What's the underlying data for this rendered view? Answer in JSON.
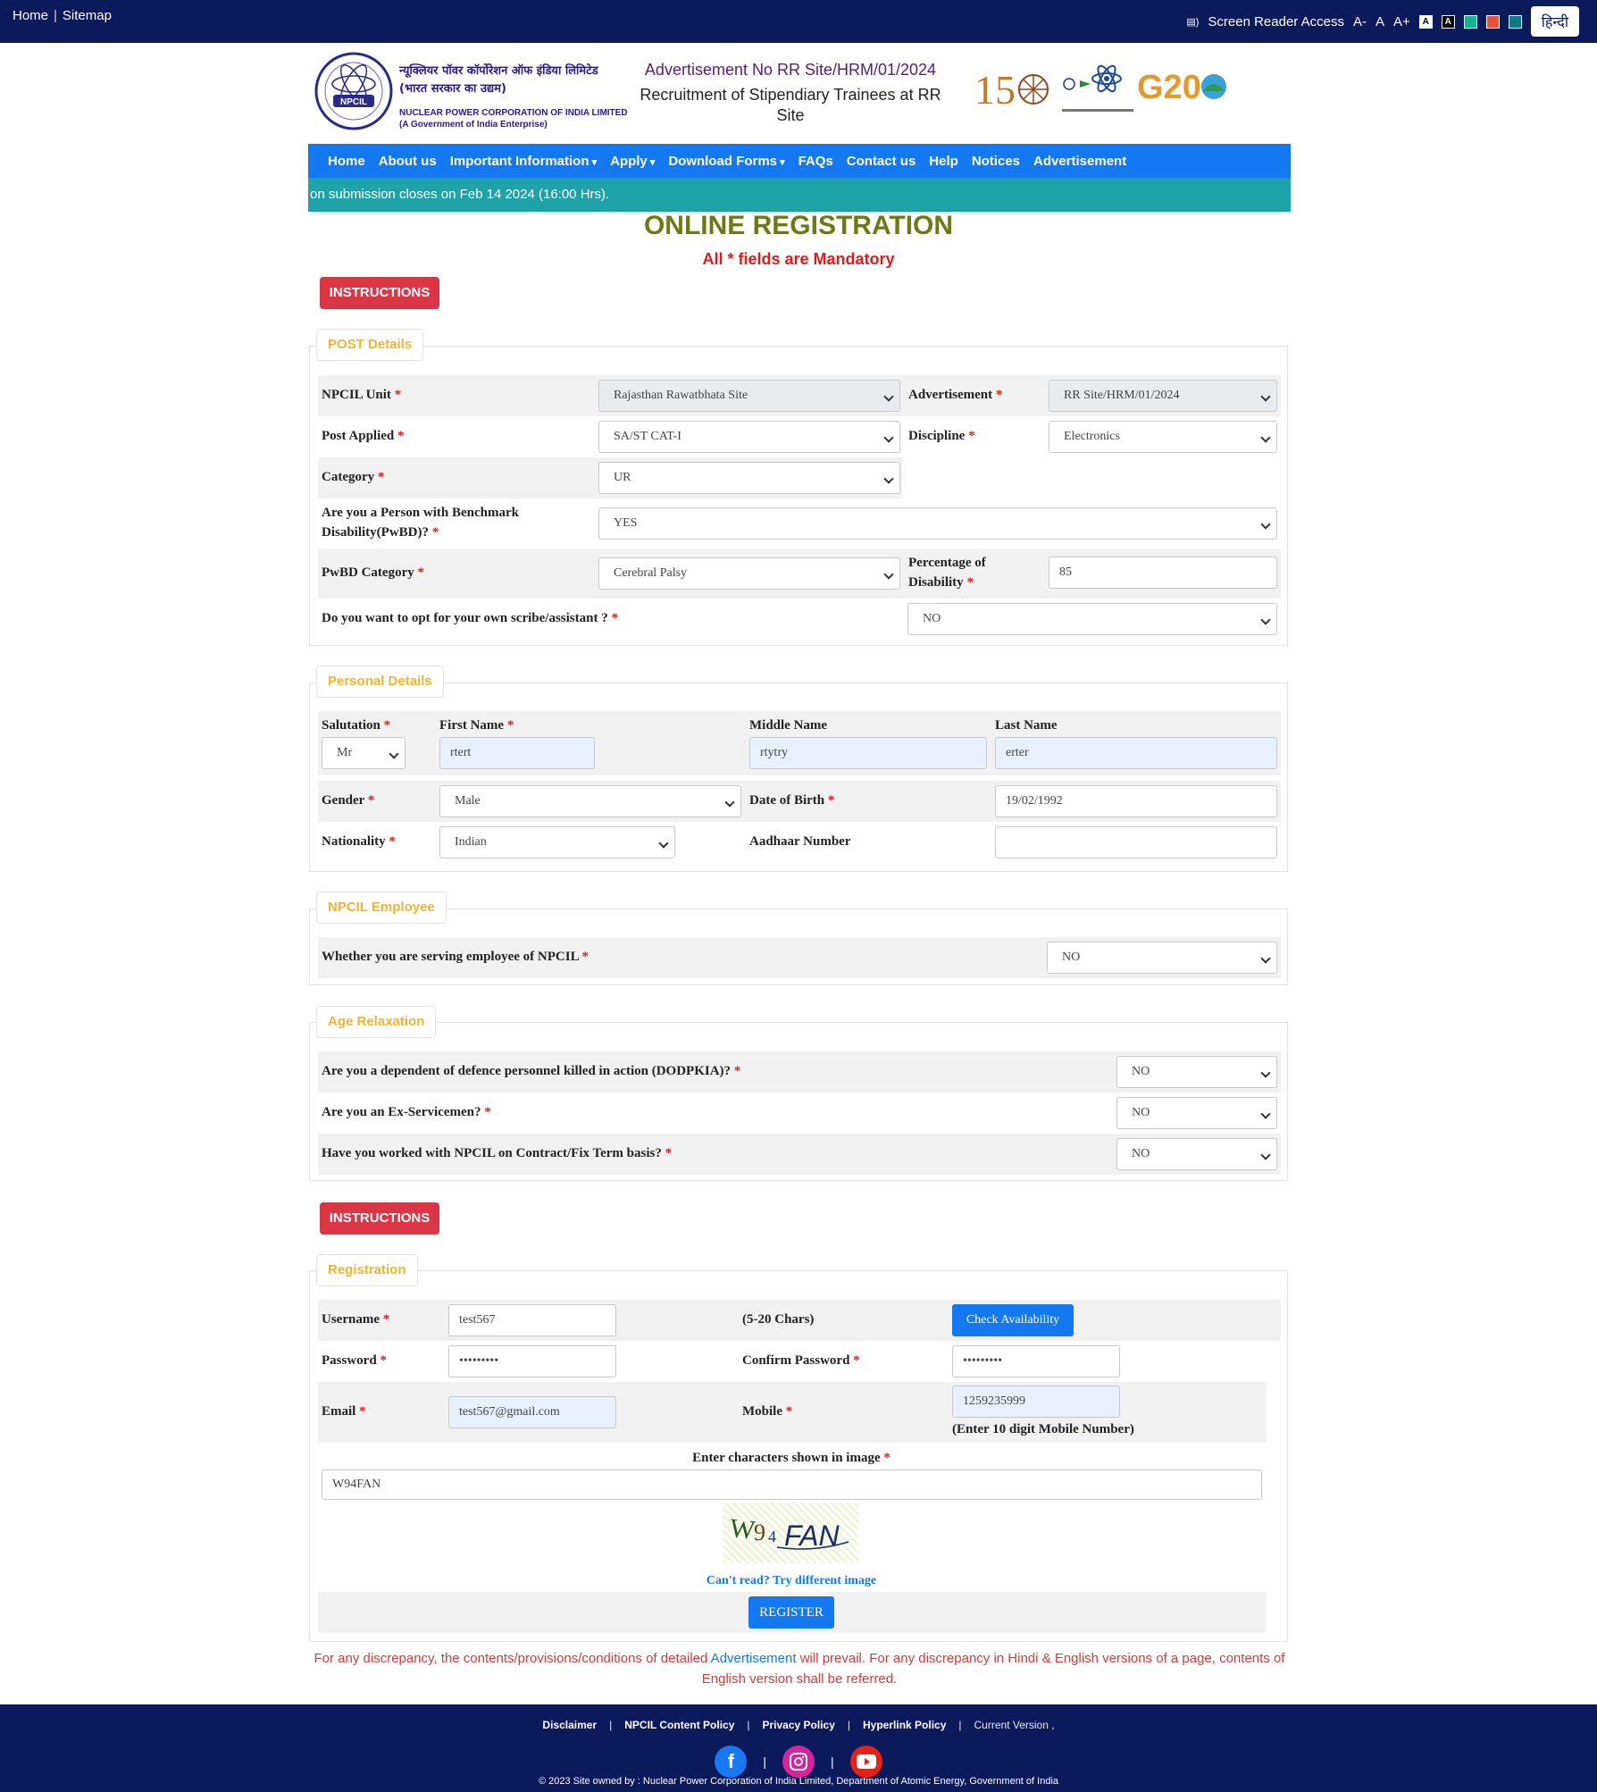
{
  "topbar": {
    "home": "Home",
    "sitemap": "Sitemap",
    "screen_reader": "Screen Reader Access",
    "font_minus": "A-",
    "font_normal": "A",
    "font_plus": "A+",
    "contrast_a1": "A",
    "contrast_a2": "A",
    "hindi": "हिन्दी",
    "theme_colors": [
      "#1ab28c",
      "#e8513c",
      "#127a82"
    ]
  },
  "header": {
    "org_hindi_1": "न्यूक्लियर पॉवर कॉर्पोरेशन ऑफ इंडिया लिमिटेड",
    "org_hindi_2": "(भारत सरकार का उद्यम)",
    "org_english_1": "NUCLEAR POWER CORPORATION OF INDIA LIMITED",
    "org_english_2": "(A Government of India Enterprise)",
    "logo_text": "NPCIL",
    "advertisement_no": "Advertisement No RR Site/HRM/01/2024",
    "recruitment_title": "Recruitment of Stipendiary Trainees at RR Site",
    "g20": "G20"
  },
  "nav": {
    "items": [
      {
        "label": "Home"
      },
      {
        "label": "About us"
      },
      {
        "label": "Important Information"
      },
      {
        "label": "Apply"
      },
      {
        "label": "Download Forms"
      },
      {
        "label": "FAQs"
      },
      {
        "label": "Contact us"
      },
      {
        "label": "Help"
      },
      {
        "label": "Notices"
      },
      {
        "label": "Advertisement"
      }
    ]
  },
  "marquee": "on submission closes on Feb 14 2024 (16:00 Hrs).",
  "title": "ONLINE REGISTRATION",
  "mandatory": "All * fields are Mandatory",
  "instructions_label": "INSTRUCTIONS",
  "post": {
    "legend": "POST Details",
    "unit_label": "NPCIL Unit",
    "unit_value": "Rajasthan Rawatbhata Site",
    "adv_label": "Advertisement",
    "adv_value": "RR Site/HRM/01/2024",
    "post_label": "Post Applied",
    "post_value": "SA/ST CAT-I",
    "discipline_label": "Discipline",
    "discipline_value": "Electronics",
    "category_label": "Category",
    "category_value": "UR",
    "pwbd_label_1": "Are you a Person with Benchmark",
    "pwbd_label_2": "Disability(PwBD)?",
    "pwbd_value": "YES",
    "pwbd_cat_label": "PwBD Category",
    "pwbd_cat_value": "Cerebral Palsy",
    "pct_label_1": "Percentage of",
    "pct_label_2": "Disability",
    "pct_value": "85",
    "scribe_label": "Do you want to opt for your own scribe/assistant ?",
    "scribe_value": "NO"
  },
  "personal": {
    "legend": "Personal Details",
    "salutation_label": "Salutation",
    "salutation_value": "Mr",
    "first_label": "First Name",
    "first_value": "rtert",
    "middle_label": "Middle Name",
    "middle_value": "rtytry",
    "last_label": "Last Name",
    "last_value": "erter",
    "gender_label": "Gender",
    "gender_value": "Male",
    "dob_label": "Date of Birth",
    "dob_value": "19/02/1992",
    "nationality_label": "Nationality",
    "nationality_value": "Indian",
    "aadhaar_label": "Aadhaar Number",
    "aadhaar_value": ""
  },
  "employee": {
    "legend": "NPCIL Employee",
    "label": "Whether you are serving employee of NPCIL",
    "value": "NO"
  },
  "age": {
    "legend": "Age Relaxation",
    "q1": "Are you a dependent of defence personnel killed in action (DODPKIA)?",
    "a1": "NO",
    "q2": "Are you an Ex-Servicemen?",
    "a2": "NO",
    "q3": "Have you worked with NPCIL on Contract/Fix Term basis?",
    "a3": "NO"
  },
  "registration": {
    "legend": "Registration",
    "username_label": "Username",
    "username_value": "test567",
    "chars_hint": "(5-20 Chars)",
    "check_btn": "Check Availability",
    "password_label": "Password",
    "password_value": "•••••••••",
    "confirm_label": "Confirm Password",
    "confirm_value": "•••••••••",
    "email_label": "Email",
    "email_value": "test567@gmail.com",
    "mobile_label": "Mobile",
    "mobile_value": "1259235999",
    "mobile_hint": "(Enter 10 digit Mobile Number)",
    "captcha_label": "Enter characters shown in image",
    "captcha_value": "W94FAN",
    "captcha_image_text": "W94FAN",
    "cant_read": "Can't read? Try different image",
    "register_btn": "REGISTER"
  },
  "disclaimer": {
    "part1": "For any discrepancy, the contents/provisions/conditions of detailed",
    "link": "Advertisement",
    "part2": "will prevail. For any discrepancy in Hindi & English versions of a page, contents of English version shall be referred."
  },
  "footer": {
    "links": [
      "Disclaimer",
      "NPCIL Content Policy",
      "Privacy Policy",
      "Hyperlink Policy",
      "Current Version ,"
    ],
    "copyright": "© 2023 Site owned by : Nuclear Power Corporation of India Limited, Department of Atomic Energy, Government of India"
  }
}
